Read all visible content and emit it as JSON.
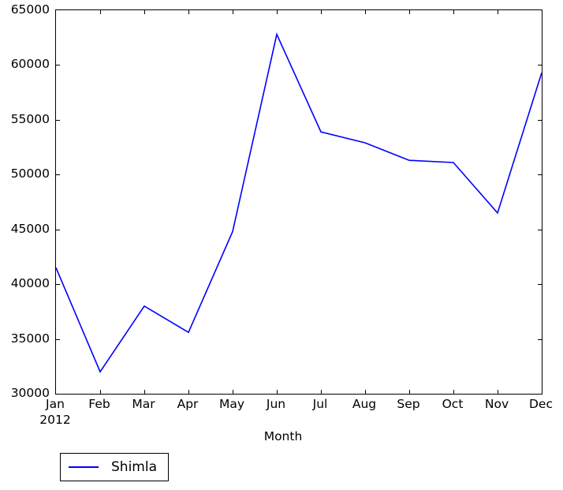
{
  "chart_data": {
    "type": "line",
    "title": "",
    "xlabel": "Month",
    "ylabel": "",
    "categories": [
      "Jan",
      "Feb",
      "Mar",
      "Apr",
      "May",
      "Jun",
      "Jul",
      "Aug",
      "Sep",
      "Oct",
      "Nov",
      "Dec"
    ],
    "x_sub_label": "2012",
    "xlim_categories": [
      "Jan",
      "Dec"
    ],
    "ylim": [
      30000,
      65000
    ],
    "ytick_values": [
      30000,
      35000,
      40000,
      45000,
      50000,
      55000,
      60000,
      65000
    ],
    "ytick_labels": [
      "30000",
      "35000",
      "40000",
      "45000",
      "50000",
      "55000",
      "60000",
      "65000"
    ],
    "grid": false,
    "legend_position": "below-left",
    "series": [
      {
        "name": "Shimla",
        "color": "#0000ff",
        "values": [
          41500,
          32000,
          38000,
          35600,
          44800,
          62800,
          53900,
          52900,
          51300,
          51100,
          46500,
          59300
        ]
      }
    ]
  },
  "axes": {
    "y_tick_labels": [
      "65000",
      "60000",
      "55000",
      "50000",
      "45000",
      "40000",
      "35000",
      "30000"
    ],
    "x_tick_labels": [
      "Jan",
      "Feb",
      "Mar",
      "Apr",
      "May",
      "Jun",
      "Jul",
      "Aug",
      "Sep",
      "Oct",
      "Nov",
      "Dec"
    ],
    "x_sub_label": "2012",
    "x_axis_title": "Month"
  },
  "legend": {
    "entries": [
      {
        "label": "Shimla",
        "color": "#0000ff"
      }
    ]
  },
  "colors": {
    "series_blue": "#0000ff",
    "axis_black": "#000000",
    "background": "#ffffff"
  }
}
